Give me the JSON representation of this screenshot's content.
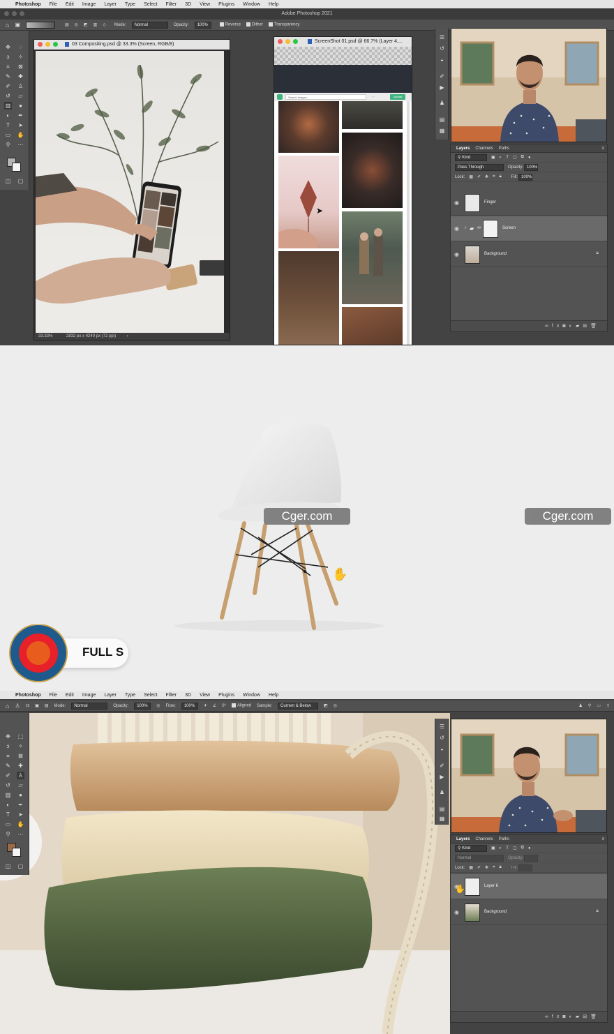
{
  "menubar": {
    "apple": "",
    "app": "Photoshop",
    "items": [
      "File",
      "Edit",
      "Image",
      "Layer",
      "Type",
      "Select",
      "Filter",
      "3D",
      "View",
      "Plugins",
      "Window",
      "Help"
    ]
  },
  "window_title": "Adobe Photoshop 2021",
  "options1": {
    "mode_label": "Mode:",
    "mode_value": "Normal",
    "opacity_label": "Opacity:",
    "opacity_value": "100%",
    "reverse": "Reverse",
    "dither": "Dither",
    "transparency": "Transparency"
  },
  "doc1": {
    "title": "03 Compositing.psd @ 33.3% (Screen, RGB/8)",
    "zoom": "33.33%",
    "size": "2832 px x 4240 px (72 ppi)"
  },
  "doc2": {
    "title": "ScreenShot 01.psd @ 66.7% (Layer 4,...",
    "search_placeholder": "Search images...",
    "button": "Upload"
  },
  "layers1": {
    "tabs": [
      "Layers",
      "Channels",
      "Paths"
    ],
    "filter": "Kind",
    "blend": "Pass Through",
    "opacity_label": "Opacity:",
    "opacity_value": "100%",
    "lock_label": "Lock:",
    "fill_label": "Fill:",
    "fill_value": "100%",
    "items": [
      {
        "name": "Finger"
      },
      {
        "name": "Screen"
      },
      {
        "name": "Background"
      }
    ]
  },
  "watermark": "Cger.com",
  "badge": {
    "text": "FULL S"
  },
  "options2": {
    "size": "19",
    "mode_label": "Mode:",
    "mode_value": "Normal",
    "opacity_label": "Opacity:",
    "opacity_value": "100%",
    "flow_label": "Flow:",
    "flow_value": "100%",
    "angle": "0°",
    "aligned": "Aligned",
    "sample_label": "Sample:",
    "sample_value": "Current & Below"
  },
  "layers2": {
    "tabs": [
      "Layers",
      "Channels",
      "Paths"
    ],
    "filter": "Kind",
    "blend": "Normal",
    "opacity_label": "Opacity:",
    "lock_label": "Lock:",
    "fill_label": "Fill:",
    "items": [
      {
        "name": "Layer 6"
      },
      {
        "name": "Background"
      }
    ]
  },
  "colors": {
    "ps_bg": "#434343",
    "panel": "#535353",
    "accent_green": "#3fb37f",
    "badge_blue": "#1e5a8c",
    "badge_red": "#e8202a",
    "badge_orange": "#e85d1e"
  }
}
